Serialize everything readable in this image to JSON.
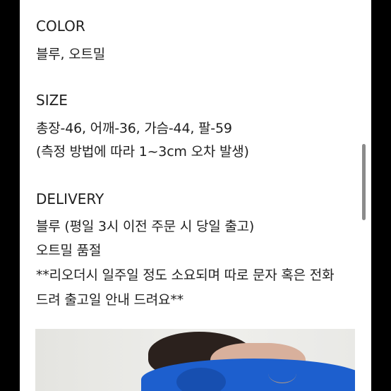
{
  "sections": {
    "color": {
      "heading": "COLOR",
      "lines": [
        "블루, 오트밀"
      ]
    },
    "size": {
      "heading": "SIZE",
      "lines": [
        "총장-46, 어깨-36, 가슴-44, 팔-59",
        "(측정 방법에 따라 1~3cm 오차 발생)"
      ]
    },
    "delivery": {
      "heading": "DELIVERY",
      "lines": [
        "블루 (평일 3시 이전  주문 시 당일 출고)",
        "오트밀 품절",
        "**리오더시 일주일 정도 소요되며 따로 문자 혹은 전화",
        "드려 출고일 안내 드려요**"
      ]
    }
  },
  "photo": {
    "icon": "product-photo",
    "sweater_color": "#1d5fce"
  },
  "colors": {
    "text": "#1f1f1f",
    "background": "#ffffff",
    "frame": "#000000",
    "scrollbar": "#8b8b8b"
  }
}
